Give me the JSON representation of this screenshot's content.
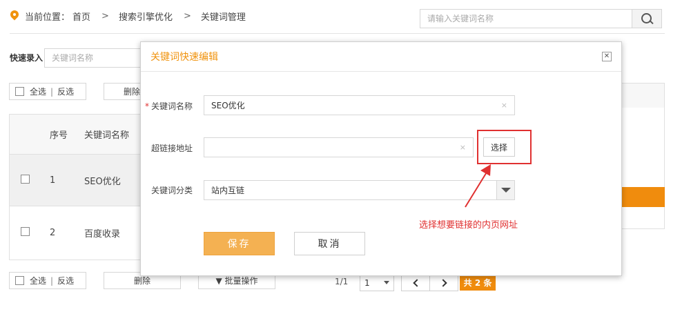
{
  "breadcrumb": {
    "prefix": "当前位置：",
    "items": [
      "首页",
      "搜索引擎优化",
      "关键词管理"
    ],
    "separator": ">"
  },
  "top_search": {
    "placeholder": "请输入关键词名称"
  },
  "quick_entry": {
    "label": "快速录入",
    "placeholder": "关键词名称"
  },
  "toolbar": {
    "select_all": "全选",
    "bar": "|",
    "invert": "反选",
    "delete": "删除",
    "batch": "▼  批量操作"
  },
  "table": {
    "columns": [
      "序号",
      "关键词名称"
    ],
    "rows": [
      {
        "no": "1",
        "name": "SEO优化"
      },
      {
        "no": "2",
        "name": "百度收录"
      }
    ]
  },
  "pagination": {
    "page_info": "1/1",
    "page_select": "1",
    "total": "共 2 条"
  },
  "dialog": {
    "title": "关键词快速编辑",
    "close_glyph": "✕",
    "required_mark": "*",
    "name_label": "关键词名称",
    "name_value": "SEO优化",
    "link_label": "超链接地址",
    "link_value": "",
    "pick_button": "选择",
    "category_label": "关键词分类",
    "category_value": "站内互链",
    "clear_glyph": "×",
    "save_button": "保存",
    "cancel_button": "取消"
  },
  "annotation": {
    "text": "选择想要链接的内页网址",
    "color": "#e03030"
  },
  "colors": {
    "accent": "#f0930e",
    "save_button": "#f4b152",
    "highlight_row": "#f0f0f0"
  }
}
